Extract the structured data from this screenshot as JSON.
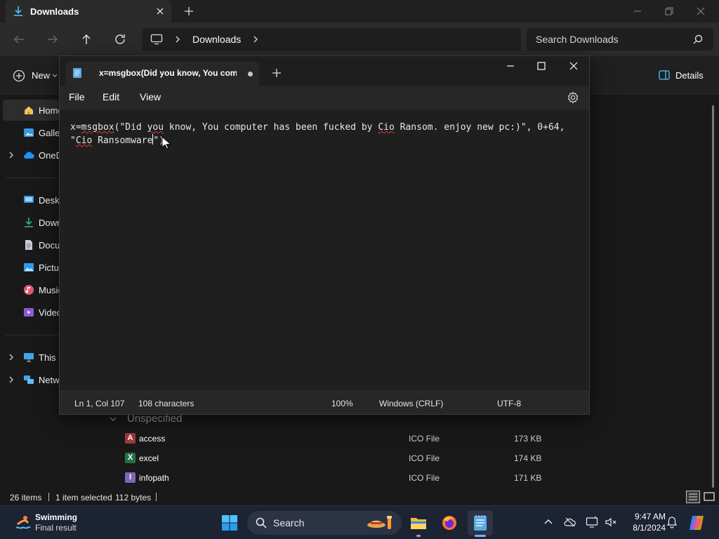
{
  "explorer": {
    "tab_title": "Downloads",
    "breadcrumb": "Downloads",
    "search_placeholder": "Search Downloads",
    "new_label": "New",
    "details_label": "Details",
    "sidebar": {
      "home": "Home",
      "gallery": "Gallery",
      "onedrive": "OneDrive",
      "desktop": "Desktop",
      "downloads": "Downloads",
      "documents": "Documents",
      "pictures": "Pictures",
      "music": "Music",
      "videos": "Videos",
      "this_pc": "This PC",
      "network": "Network"
    },
    "group_header": "Unspecified",
    "files": [
      {
        "name": "access",
        "type": "ICO File",
        "size": "173 KB",
        "badge": "A",
        "color": "#a4373a"
      },
      {
        "name": "excel",
        "type": "ICO File",
        "size": "174 KB",
        "badge": "X",
        "color": "#217346"
      },
      {
        "name": "infopath",
        "type": "ICO File",
        "size": "171 KB",
        "badge": "I",
        "color": "#7f64b8"
      }
    ],
    "status": {
      "items": "26 items",
      "selected": "1 item selected",
      "size": "112 bytes"
    }
  },
  "notepad": {
    "tab_title": "x=msgbox(Did you know, You com",
    "menu": {
      "file": "File",
      "edit": "Edit",
      "view": "View"
    },
    "text": {
      "l1_a": "x=",
      "l1_msgbox": "msgbox",
      "l1_b": "(\"Did ",
      "l1_you": "you",
      "l1_c": " know, You computer has been fucked by ",
      "l1_cio": "Cio",
      "l1_d": " Ransom. enjoy new pc:)\", 0+64,",
      "l2_a": "\"",
      "l2_cio": "Cio",
      "l2_b": " Ransomware",
      "l2_c": "\")"
    },
    "status": {
      "position": "Ln 1, Col 107",
      "chars": "108 characters",
      "zoom": "100%",
      "line_ending": "Windows (CRLF)",
      "encoding": "UTF-8"
    }
  },
  "taskbar": {
    "weather_title": "Swimming",
    "weather_sub": "Final result",
    "search_label": "Search",
    "time": "9:47 AM",
    "date": "8/1/2024"
  }
}
